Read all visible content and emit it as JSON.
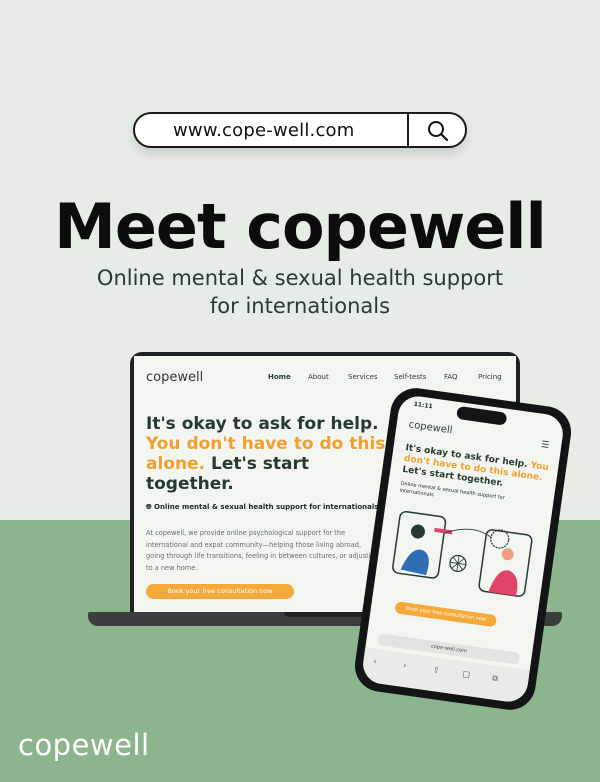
{
  "search": {
    "url": "www.cope-well.com",
    "icon": "search-icon"
  },
  "hero": {
    "title": "Meet copewell",
    "subtitle_line1": "Online mental & sexual health support",
    "subtitle_line2": "for internationals"
  },
  "laptop": {
    "logo": "copewell",
    "nav": [
      "Home",
      "About",
      "Services",
      "Self-tests",
      "FAQ",
      "Pricing"
    ],
    "headline_part1": "It's okay to ask for help. ",
    "headline_highlight": "You don't have to do this alone.",
    "headline_part2": " Let's start together.",
    "tagline": "Online mental & sexual health support for internationals",
    "paragraph": "At copewell, we provide online psychological support for the international and expat community—helping those living abroad, going through life transitions, feeling in between cultures, or adjusting to a new home.",
    "cta": "Book your free consultation now"
  },
  "phone": {
    "time": "11:11",
    "logo": "copewell",
    "headline_part1": "It's okay to ask for help. ",
    "headline_highlight": "You don't have to do this alone.",
    "headline_part2": " Let's start together.",
    "tagline": "Online mental & sexual health support for internationals",
    "cta": "Book your free consultation now",
    "address": "cope-well.com"
  },
  "footer": {
    "logo": "copewell"
  },
  "colors": {
    "accent": "#f0a030",
    "green": "#8cb48d",
    "background": "#e5ede5",
    "dark": "#263a30"
  }
}
